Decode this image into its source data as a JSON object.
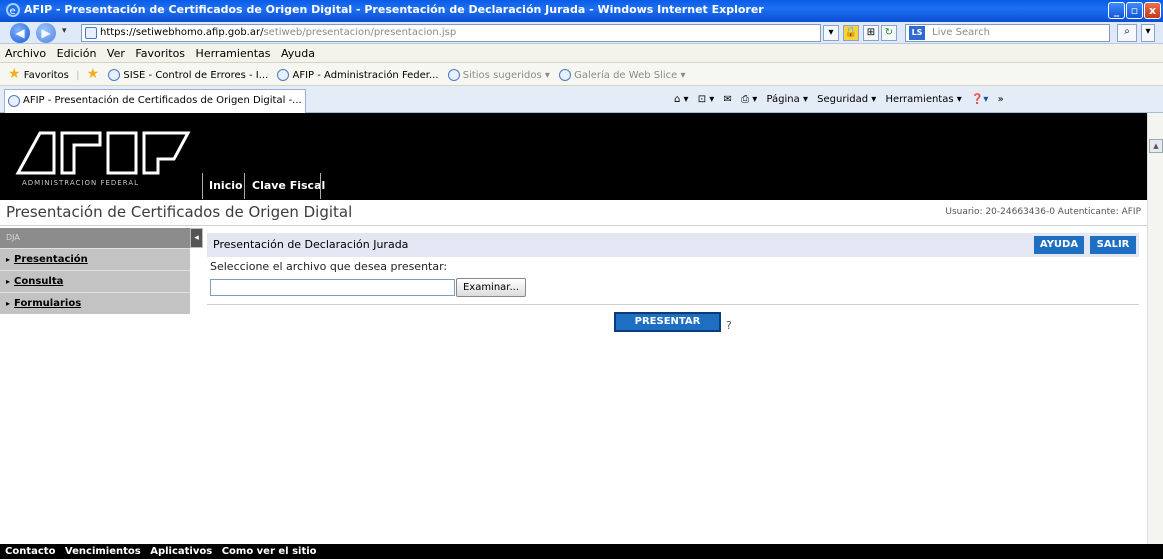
{
  "window": {
    "title": "AFIP - Presentación de Certificados de Origen Digital - Presentación de Declaración Jurada - Windows Internet Explorer",
    "min": "_",
    "max": "▫",
    "close": "x"
  },
  "address": {
    "url_main": "https://setiwebhomo.afip.gob.ar/",
    "url_rest": "setiweb/presentacion/presentacion.jsp",
    "search_placeholder": "Live Search"
  },
  "menu": [
    "Archivo",
    "Edición",
    "Ver",
    "Favoritos",
    "Herramientas",
    "Ayuda"
  ],
  "favorites": {
    "label": "Favoritos",
    "items": [
      {
        "label": "SISE - Control de Errores - I...",
        "greyed": false
      },
      {
        "label": "AFIP - Administración Feder...",
        "greyed": false
      },
      {
        "label": "Sitios sugeridos ▾",
        "greyed": true
      },
      {
        "label": "Galería de Web Slice ▾",
        "greyed": true
      }
    ]
  },
  "tab": {
    "label": "AFIP - Presentación de Certificados de Origen Digital -..."
  },
  "tools": {
    "pagina": "Página ▾",
    "seguridad": "Seguridad ▾",
    "herramientas": "Herramientas ▾"
  },
  "afip": {
    "logo_subtitle": "ADMINISTRACION FEDERAL",
    "nav": [
      "Inicio",
      "Clave Fiscal"
    ],
    "app_title": "Presentación de Certificados de Origen Digital",
    "user_info": "Usuario: 20-24663436-0 Autenticante: AFIP"
  },
  "sidebar": {
    "header": "DJA",
    "items": [
      {
        "label": "Presentación"
      },
      {
        "label": "Consulta"
      },
      {
        "label": "Formularios"
      }
    ]
  },
  "content": {
    "panel_title": "Presentación de Declaración Jurada",
    "ayuda": "AYUDA",
    "salir": "SALIR",
    "prompt": "Seleccione el archivo que desea presentar:",
    "file_value": "",
    "browse": "Examinar...",
    "submit": "PRESENTAR",
    "help": "?"
  },
  "footer": [
    "Contacto",
    "Vencimientos",
    "Aplicativos",
    "Como ver el sitio"
  ],
  "colors": {
    "accent_blue": "#1e6fc2",
    "header_black": "#000000",
    "sidebar_grey": "#c3c3c3"
  }
}
